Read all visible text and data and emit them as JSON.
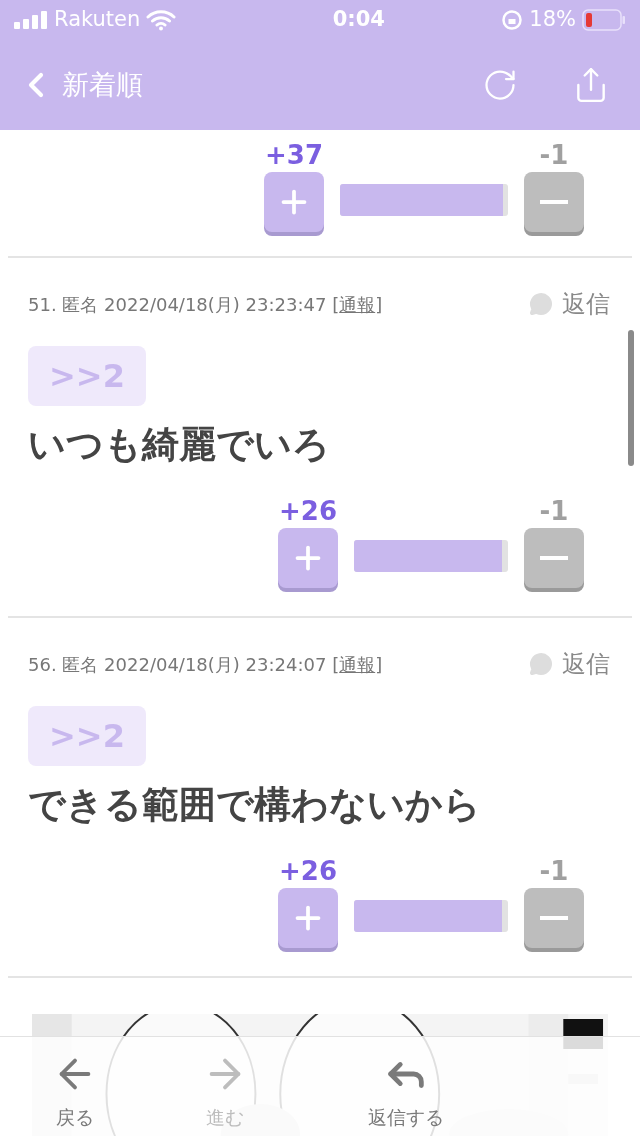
{
  "status_bar": {
    "carrier": "Rakuten",
    "time": "0:04",
    "battery": "18%"
  },
  "nav": {
    "title": "新着順"
  },
  "top_votes": {
    "plus": "+37",
    "minus": "-1",
    "level": 0.97
  },
  "posts": [
    {
      "meta": "51. 匿名 2022/04/18(月) 23:23:47 [",
      "report_link": "通報",
      "meta_end": "]",
      "reply": "返信",
      "anchor": ">>2",
      "body": "いつも綺麗でいろ",
      "plus": "+26",
      "minus": "-1",
      "level": 0.96
    },
    {
      "meta": "56. 匿名 2022/04/18(月) 23:24:07 [",
      "report_link": "通報",
      "meta_end": "]",
      "reply": "返信",
      "anchor": ">>2",
      "body": "できる範囲で構わないから",
      "plus": "+26",
      "minus": "-1",
      "level": 0.96
    }
  ],
  "toolbar": [
    {
      "kind": "back",
      "label": "戻る",
      "disabled": false
    },
    {
      "kind": "forward",
      "label": "進む",
      "disabled": true
    },
    {
      "kind": "reply",
      "label": "返信する",
      "disabled": false
    }
  ]
}
